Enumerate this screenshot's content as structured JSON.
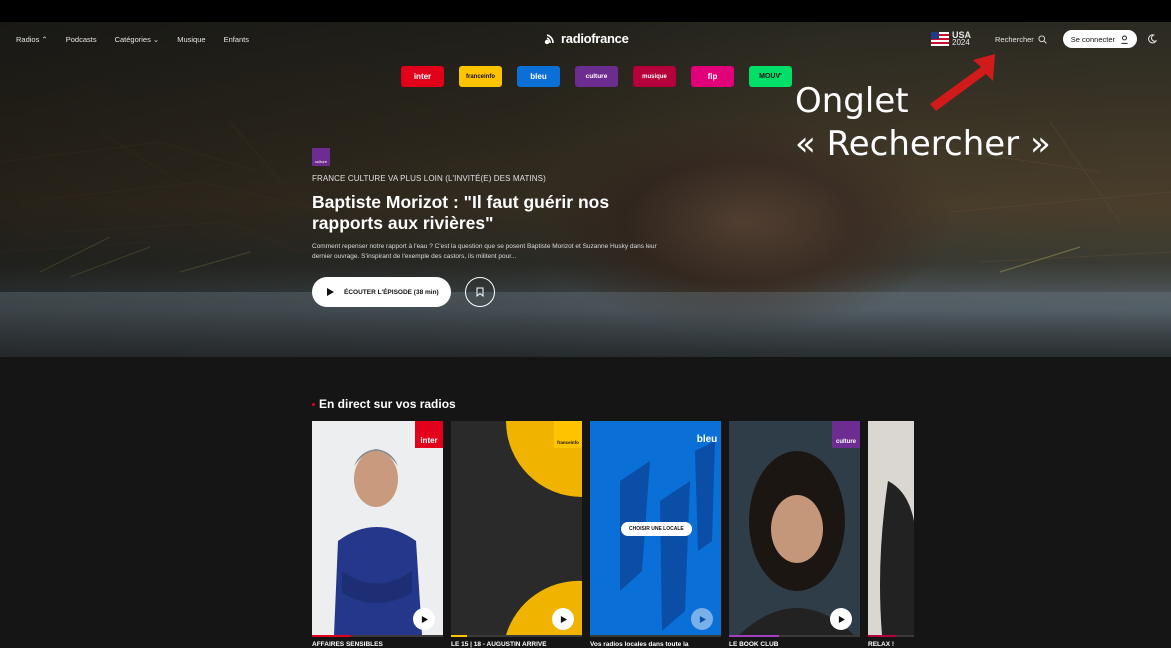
{
  "nav": {
    "left": [
      "Radios ⌃",
      "Podcasts",
      "Catégories ⌄",
      "Musique",
      "Enfants"
    ],
    "logo": "radiofrance",
    "usa_line1": "USA",
    "usa_line2": "2024",
    "search_label": "Rechercher",
    "connect_label": "Se connecter"
  },
  "stations": [
    {
      "label": "inter",
      "color": "#e2001a"
    },
    {
      "label": "franceinfo",
      "color": "#ffc300"
    },
    {
      "label": "bleu",
      "color": "#0a6fd6"
    },
    {
      "label": "culture",
      "color": "#6d2c8f"
    },
    {
      "label": "musique",
      "color": "#b5003c"
    },
    {
      "label": "fip",
      "color": "#e2007a"
    },
    {
      "label": "MOUV'",
      "color": "#00e069"
    }
  ],
  "annotation": {
    "line1": "Onglet",
    "line2": "« Rechercher »",
    "arrow_color": "#d11a1a"
  },
  "hero": {
    "badge": "culture",
    "kicker": "FRANCE CULTURE VA PLUS LOIN (L'INVITÉ(E) DES MATINS)",
    "title": "Baptiste Morizot : \"Il faut guérir nos rapports aux rivières\"",
    "description": "Comment repenser notre rapport à l'eau ? C'est la question que se posent Baptiste Morizot et Suzanne Husky dans leur dernier ouvrage. S'inspirant de l'exemple des castors, ils militent pour...",
    "play_label": "ÉCOUTER L'ÉPISODE (38 min)"
  },
  "live": {
    "section_title": "En direct sur vos radios",
    "choose_local": "CHOISIR UNE LOCALE",
    "cards": [
      {
        "caption": "AFFAIRES SENSIBLES",
        "corner": "inter",
        "accent": "#e2001a",
        "progress": 0.3
      },
      {
        "caption": "LE 15 | 18 - AUGUSTIN ARRIVÉ",
        "corner": "franceinfo",
        "accent": "#ffc300",
        "progress": 0.12
      },
      {
        "caption": "Vos radios locales dans toute la",
        "corner": "bleu",
        "accent": "#0a6fd6",
        "progress": 0
      },
      {
        "caption": "LE BOOK CLUB",
        "corner": "culture",
        "accent": "#a040c0",
        "progress": 0.38
      },
      {
        "caption": "RELAX !",
        "corner": "",
        "accent": "#b5003c",
        "progress": 0.6
      }
    ]
  }
}
